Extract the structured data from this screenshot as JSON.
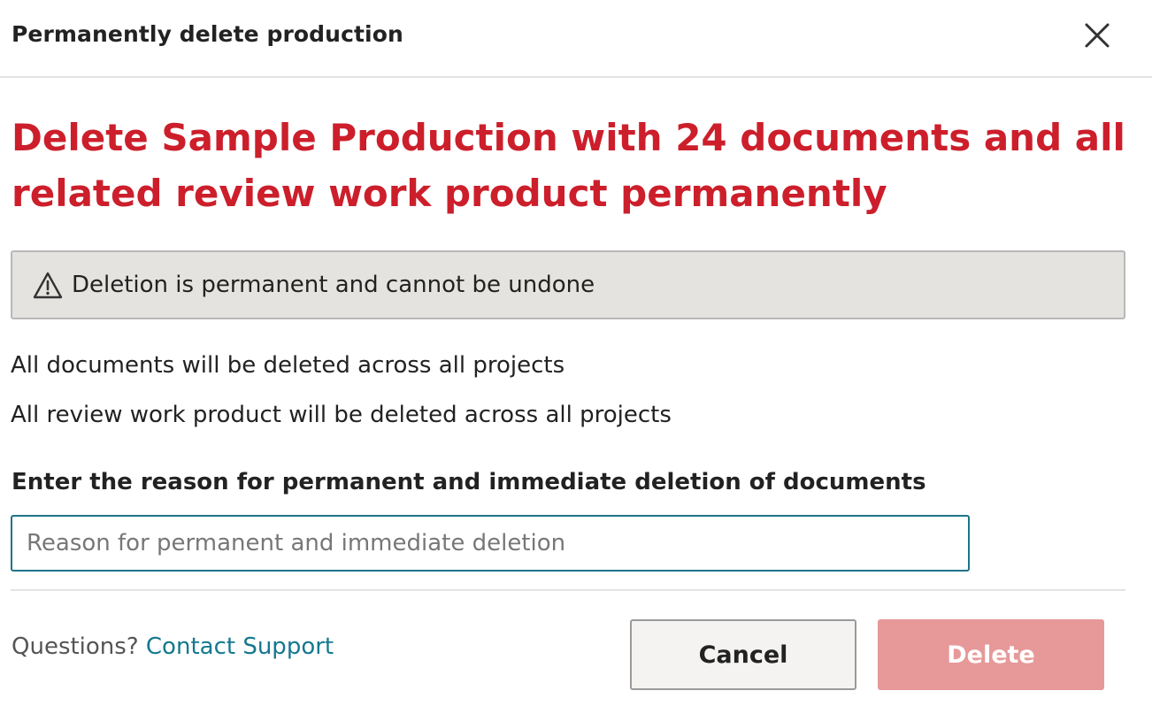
{
  "dialog": {
    "title": "Permanently delete production",
    "close_icon": "close-icon"
  },
  "headline": "Delete Sample Production with 24 documents and all related review work product permanently",
  "warning": {
    "icon": "warning-triangle-icon",
    "text": "Deletion is permanent and cannot be undone"
  },
  "info": [
    "All documents will be deleted across all projects",
    "All review work product will be deleted across all projects"
  ],
  "reason_field": {
    "label": "Enter the reason for permanent and immediate deletion of documents",
    "placeholder": "Reason for permanent and immediate deletion",
    "value": ""
  },
  "footer": {
    "questions_text": "Questions?",
    "support_link": "Contact Support",
    "cancel_label": "Cancel",
    "delete_label": "Delete",
    "delete_enabled": false
  },
  "colors": {
    "danger": "#cc1f2b",
    "link": "#15788f",
    "delete_disabled": "#e79898",
    "input_border_focus": "#1e7488",
    "warning_bg": "#e4e3df"
  }
}
